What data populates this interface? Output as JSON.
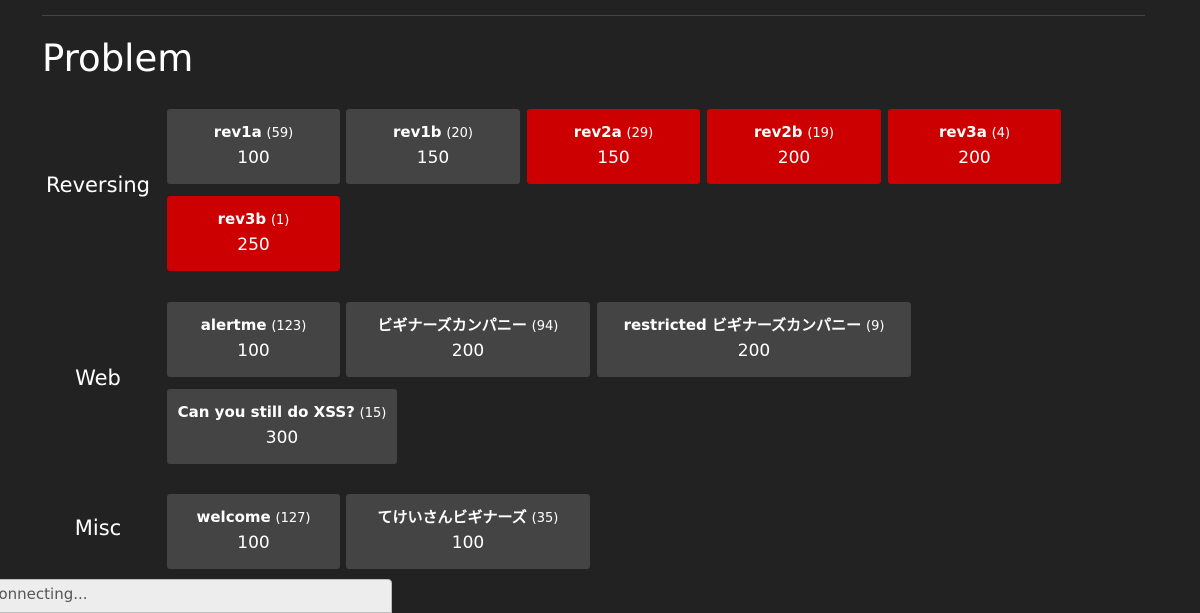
{
  "page": {
    "title": "Problem"
  },
  "categories": [
    {
      "name": "Reversing",
      "problems": [
        {
          "name": "rev1a",
          "count": "(59)",
          "points": "100",
          "solved": false
        },
        {
          "name": "rev1b",
          "count": "(20)",
          "points": "150",
          "solved": false
        },
        {
          "name": "rev2a",
          "count": "(29)",
          "points": "150",
          "solved": true
        },
        {
          "name": "rev2b",
          "count": "(19)",
          "points": "200",
          "solved": true
        },
        {
          "name": "rev3a",
          "count": "(4)",
          "points": "200",
          "solved": true
        },
        {
          "name": "rev3b",
          "count": "(1)",
          "points": "250",
          "solved": true
        }
      ]
    },
    {
      "name": "Web",
      "problems": [
        {
          "name": "alertme",
          "count": "(123)",
          "points": "100",
          "solved": false
        },
        {
          "name": "ビギナーズカンパニー",
          "count": "(94)",
          "points": "200",
          "solved": false
        },
        {
          "name": "restricted ビギナーズカンパニー",
          "count": "(9)",
          "points": "200",
          "solved": false
        },
        {
          "name": "Can you still do XSS?",
          "count": "(15)",
          "points": "300",
          "solved": false
        }
      ]
    },
    {
      "name": "Misc",
      "problems": [
        {
          "name": "welcome",
          "count": "(127)",
          "points": "100",
          "solved": false
        },
        {
          "name": "てけいさんビギナーズ",
          "count": "(35)",
          "points": "100",
          "solved": false
        }
      ]
    }
  ],
  "status_bar": {
    "text": "Connecting..."
  },
  "colors": {
    "background": "#222222",
    "card_default": "#444444",
    "card_solved": "#cc0000",
    "status_bar": "#ededed"
  }
}
